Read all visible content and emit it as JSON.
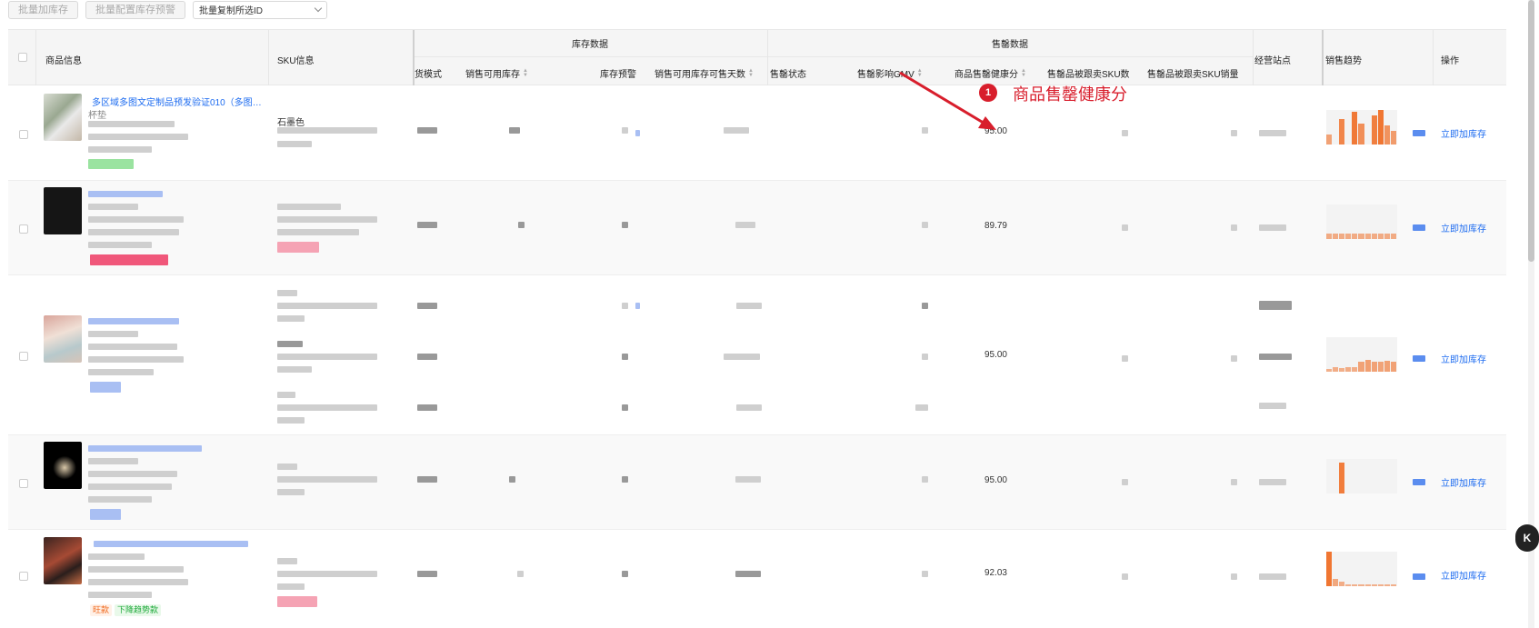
{
  "toolbar": {
    "batch_add_stock": "批量加库存",
    "batch_config_alert": "批量配置库存预警",
    "copy_ids_select": "批量复制所选ID"
  },
  "header": {
    "product_info": "商品信息",
    "sku_info": "SKU信息",
    "stock_group": "库存数据",
    "sellout_group": "售罄数据",
    "delivery_mode": "货模式",
    "available_stock": "销售可用库存",
    "stock_alert": "库存预警",
    "available_days": "销售可用库存可售天数",
    "sellout_status": "售罄状态",
    "sellout_gmv": "售罄影响GMV",
    "health_score": "商品售罄健康分",
    "followed_sku_count": "售罄品被跟卖SKU数",
    "followed_sku_sales": "售罄品被跟卖SKU销量",
    "sites": "经营站点",
    "sales_trend": "销售趋势",
    "actions": "操作"
  },
  "rows": [
    {
      "title": "多区域多图文定制品预发验证010（多图单...",
      "subtitle": "杯垫",
      "sku": "石墨色",
      "score": "95.00",
      "action": "立即加库存",
      "trend": [
        30,
        0,
        75,
        0,
        95,
        60,
        0,
        85,
        100,
        55,
        40
      ]
    },
    {
      "score": "89.79",
      "action": "立即加库存",
      "trend": [
        15,
        15,
        15,
        15,
        15,
        15,
        15,
        15,
        15,
        15,
        15
      ]
    },
    {
      "score": "95.00",
      "action": "立即加库存",
      "trend": [
        8,
        12,
        10,
        14,
        12,
        30,
        35,
        30,
        28,
        32,
        30
      ]
    },
    {
      "score": "95.00",
      "action": "立即加库存",
      "trend": [
        0,
        0,
        90,
        0,
        0,
        0,
        0,
        0,
        0,
        0,
        0
      ]
    },
    {
      "score": "92.03",
      "action": "立即加库存",
      "trend": [
        100,
        20,
        12,
        6,
        6,
        6,
        6,
        6,
        6,
        6,
        6
      ],
      "tags": [
        "旺款",
        "下降趋势款"
      ]
    }
  ],
  "annotation": {
    "number": "1",
    "text": "商品售罄健康分"
  },
  "colors": {
    "accent": "#1e6cf0",
    "annotation": "#d81e2c",
    "trend_bar": "#f07632"
  },
  "icons": {
    "floating": "helper-icon"
  }
}
